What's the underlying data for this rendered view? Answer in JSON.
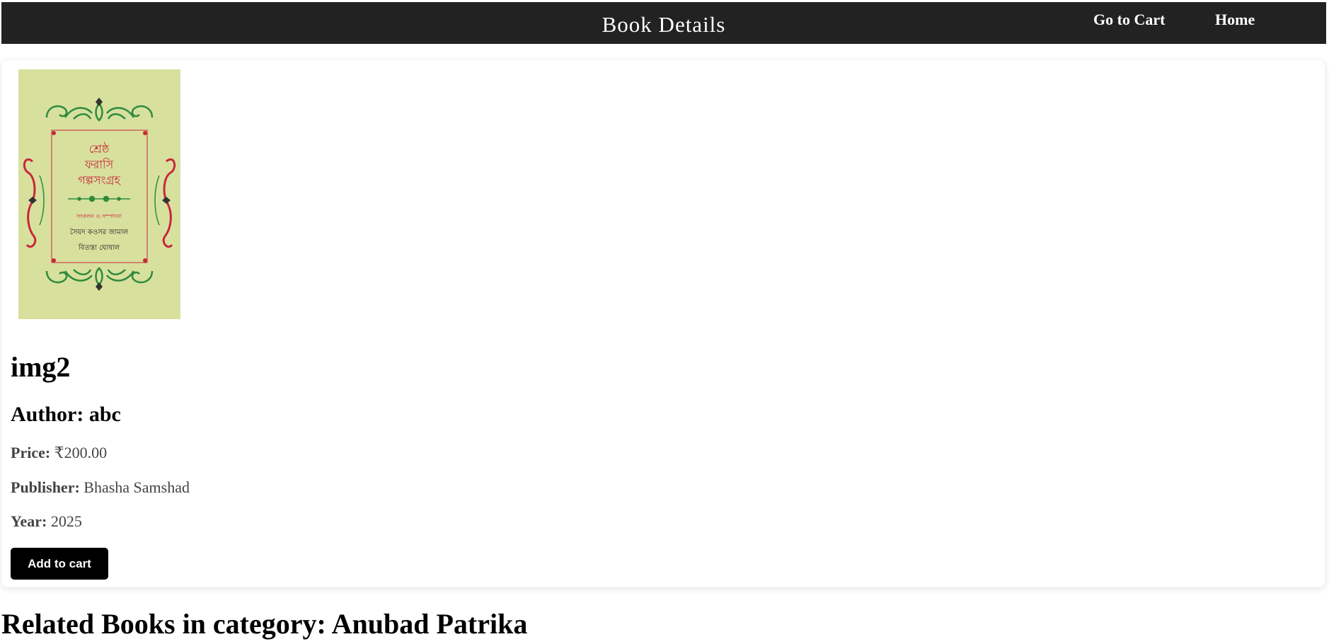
{
  "header": {
    "title": "Book Details",
    "nav": {
      "cart_label": "Go to Cart",
      "home_label": "Home"
    }
  },
  "book": {
    "cover": {
      "background_color": "#d8e09e",
      "ornament_green": "#2e8b3e",
      "ornament_red": "#c8283a",
      "title_lines": [
        "শ্রেষ্ঠ",
        "ফরাসি",
        "গল্পসংগ্রহ"
      ],
      "subtitle": "সংকলন ও সম্পাদনা",
      "editors": [
        "সৈয়দ কওসর জামাল",
        "বিতস্তা ঘোষাল"
      ]
    },
    "title": "img2",
    "author_label": "Author:",
    "author": "abc",
    "price_label": "Price:",
    "price": "₹200.00",
    "publisher_label": "Publisher:",
    "publisher": "Bhasha Samshad",
    "year_label": "Year:",
    "year": "2025",
    "add_to_cart_label": "Add to cart"
  },
  "related": {
    "heading": "Related Books in category: Anubad Patrika"
  }
}
